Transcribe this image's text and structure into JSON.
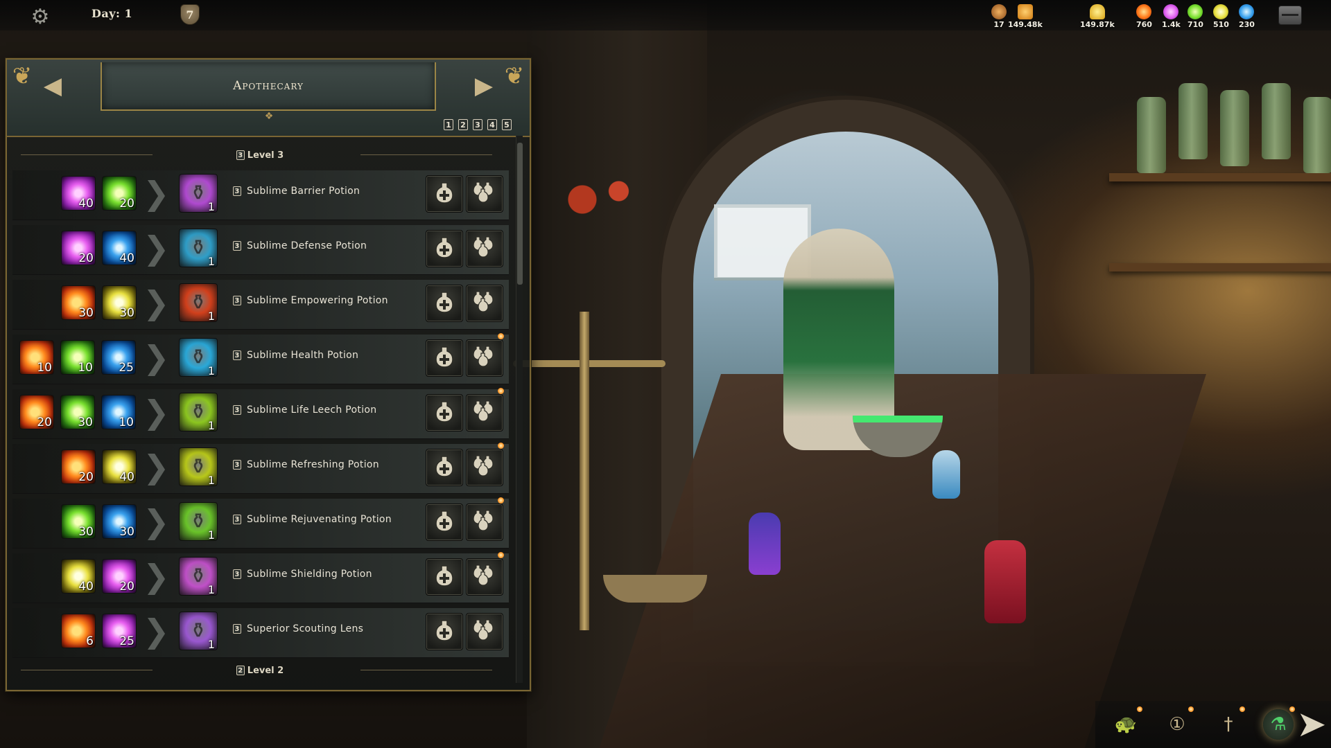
{
  "top_bar": {
    "day_label": "Day: 1",
    "shield_value": "7",
    "resources": [
      {
        "name": "units",
        "icon": "villager-icon",
        "value": "17",
        "color": "#c9863a"
      },
      {
        "name": "food",
        "icon": "cheese-icon",
        "value": "149.48k",
        "color": "#e8a02a"
      },
      {
        "name": "gold",
        "icon": "gold-pile-icon",
        "value": "149.87k",
        "color": "#f0c020"
      },
      {
        "name": "fire_essence",
        "icon": "fire-essence-icon",
        "value": "760",
        "color": "#ff7a1a"
      },
      {
        "name": "arcane_essence",
        "icon": "arcane-essence-icon",
        "value": "1.4k",
        "color": "#e060f0"
      },
      {
        "name": "nature_essence",
        "icon": "nature-essence-icon",
        "value": "710",
        "color": "#7ae030"
      },
      {
        "name": "light_essence",
        "icon": "light-essence-icon",
        "value": "510",
        "color": "#e8e040"
      },
      {
        "name": "water_essence",
        "icon": "water-essence-icon",
        "value": "230",
        "color": "#3aa2ee"
      }
    ]
  },
  "panel": {
    "title": "Apothecary",
    "pages": [
      "1",
      "2",
      "3",
      "4",
      "5"
    ],
    "level_current": {
      "number": "3",
      "label": "Level 3"
    },
    "level_next": {
      "number": "2",
      "label": "Level 2"
    },
    "recipes": [
      {
        "name": "Sublime Barrier Potion",
        "level": "3",
        "result_qty": "1",
        "result_color": "#b04ad0",
        "ingredients": [
          {
            "type": "arcane",
            "qty": "40"
          },
          {
            "type": "nature",
            "qty": "20"
          }
        ],
        "notify": false
      },
      {
        "name": "Sublime Defense Potion",
        "level": "3",
        "result_qty": "1",
        "result_color": "#2f9ec8",
        "ingredients": [
          {
            "type": "arcane",
            "qty": "20"
          },
          {
            "type": "water",
            "qty": "40"
          }
        ],
        "notify": false
      },
      {
        "name": "Sublime Empowering Potion",
        "level": "3",
        "result_qty": "1",
        "result_color": "#d2401c",
        "ingredients": [
          {
            "type": "fire",
            "qty": "30"
          },
          {
            "type": "light",
            "qty": "30"
          }
        ],
        "notify": false
      },
      {
        "name": "Sublime Health Potion",
        "level": "3",
        "result_qty": "1",
        "result_color": "#2aa8d8",
        "ingredients": [
          {
            "type": "fire",
            "qty": "10"
          },
          {
            "type": "nature",
            "qty": "10"
          },
          {
            "type": "water",
            "qty": "25"
          }
        ],
        "notify": true
      },
      {
        "name": "Sublime Life Leech Potion",
        "level": "3",
        "result_qty": "1",
        "result_color": "#8cc620",
        "ingredients": [
          {
            "type": "fire",
            "qty": "20"
          },
          {
            "type": "nature",
            "qty": "30"
          },
          {
            "type": "water",
            "qty": "10"
          }
        ],
        "notify": true
      },
      {
        "name": "Sublime Refreshing Potion",
        "level": "3",
        "result_qty": "1",
        "result_color": "#b8c81a",
        "ingredients": [
          {
            "type": "fire",
            "qty": "20"
          },
          {
            "type": "light",
            "qty": "40"
          }
        ],
        "notify": true
      },
      {
        "name": "Sublime Rejuvenating Potion",
        "level": "3",
        "result_qty": "1",
        "result_color": "#6ac42a",
        "ingredients": [
          {
            "type": "nature",
            "qty": "30"
          },
          {
            "type": "water",
            "qty": "30"
          }
        ],
        "notify": true
      },
      {
        "name": "Sublime Shielding Potion",
        "level": "3",
        "result_qty": "1",
        "result_color": "#c050c8",
        "ingredients": [
          {
            "type": "light",
            "qty": "40"
          },
          {
            "type": "arcane",
            "qty": "20"
          }
        ],
        "notify": true
      },
      {
        "name": "Superior Scouting Lens",
        "level": "3",
        "result_qty": "1",
        "result_color": "#9a58d0",
        "ingredients": [
          {
            "type": "fire",
            "qty": "6"
          },
          {
            "type": "arcane",
            "qty": "25"
          }
        ],
        "notify": false
      }
    ]
  },
  "bottom_toolbar": [
    {
      "icon": "turtle-icon",
      "active": false,
      "notify": true
    },
    {
      "icon": "speed-one-icon",
      "active": false,
      "notify": true
    },
    {
      "icon": "sword-icon",
      "active": false,
      "notify": true
    },
    {
      "icon": "potion-cross-icon",
      "active": true,
      "notify": true
    }
  ]
}
